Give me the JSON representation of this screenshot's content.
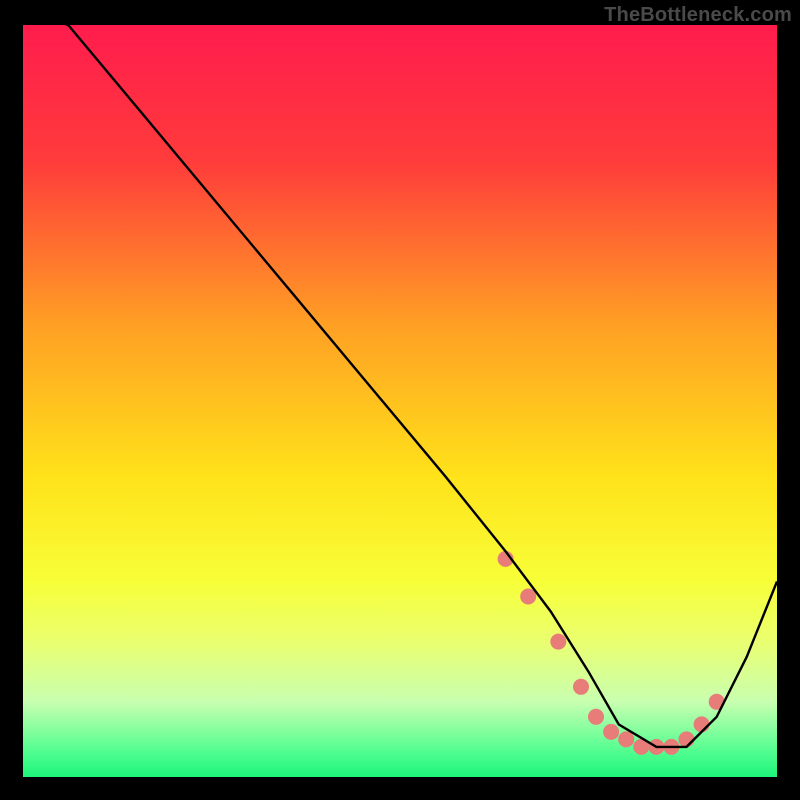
{
  "watermark": "TheBottleneck.com",
  "chart_data": {
    "type": "line",
    "title": "",
    "xlabel": "",
    "ylabel": "",
    "xlim": [
      0,
      100
    ],
    "ylim": [
      0,
      100
    ],
    "grid": false,
    "gradient_stops": [
      {
        "offset": 0.0,
        "color": "#ff1c4d"
      },
      {
        "offset": 0.18,
        "color": "#ff3b3b"
      },
      {
        "offset": 0.4,
        "color": "#ffa024"
      },
      {
        "offset": 0.6,
        "color": "#ffe21a"
      },
      {
        "offset": 0.74,
        "color": "#f7ff38"
      },
      {
        "offset": 0.82,
        "color": "#eaff70"
      },
      {
        "offset": 0.9,
        "color": "#c8ffb0"
      },
      {
        "offset": 0.97,
        "color": "#4bfd8e"
      },
      {
        "offset": 1.0,
        "color": "#1df57a"
      }
    ],
    "series": [
      {
        "name": "curve",
        "x": [
          0,
          6,
          16,
          26,
          36,
          46,
          56,
          64,
          70,
          75,
          79,
          84,
          88,
          92,
          96,
          100
        ],
        "y": [
          102,
          100,
          88,
          76,
          64,
          52,
          40,
          30,
          22,
          14,
          7,
          4,
          4,
          8,
          16,
          26
        ]
      }
    ],
    "markers": {
      "x": [
        64,
        67,
        71,
        74,
        76,
        78,
        80,
        82,
        84,
        86,
        88,
        90,
        92
      ],
      "y": [
        29,
        24,
        18,
        12,
        8,
        6,
        5,
        4,
        4,
        4,
        5,
        7,
        10
      ],
      "color": "#e77c78",
      "radius": 8
    }
  }
}
